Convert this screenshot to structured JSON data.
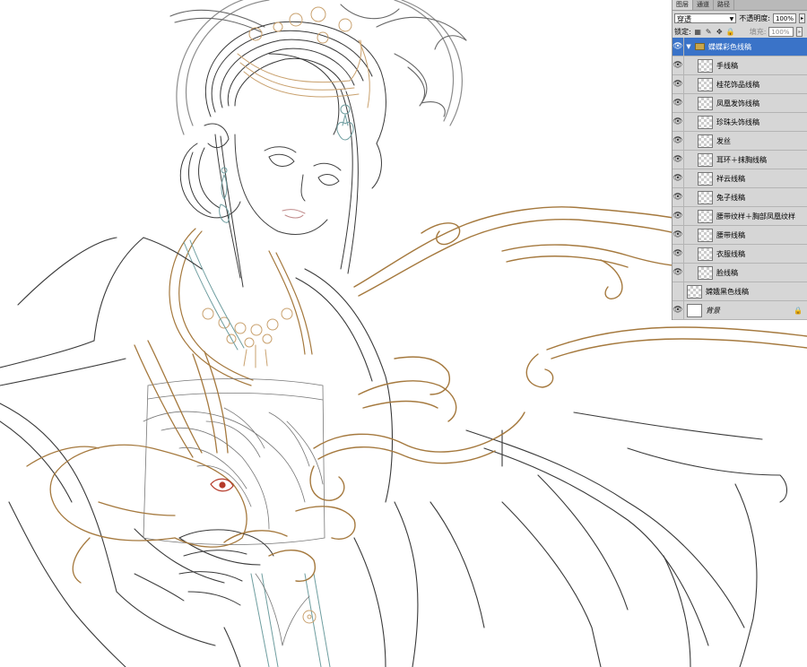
{
  "panel": {
    "tabs": [
      "图层",
      "通道",
      "路径"
    ],
    "blend_mode": "穿透",
    "opacity_label": "不透明度:",
    "opacity_value": "100%",
    "lock_label": "锁定:",
    "fill_label": "填充:",
    "fill_value": "100%"
  },
  "layers": [
    {
      "name": "蝶蝶彩色线稿",
      "type": "group",
      "visible": true,
      "selected": true
    },
    {
      "name": "手线稿",
      "visible": true
    },
    {
      "name": "桂花饰品线稿",
      "visible": true
    },
    {
      "name": "凤凰发饰线稿",
      "visible": true
    },
    {
      "name": "珍珠头饰线稿",
      "visible": true
    },
    {
      "name": "发丝",
      "visible": true
    },
    {
      "name": "耳环＋抹胸线稿",
      "visible": true
    },
    {
      "name": "祥云线稿",
      "visible": true
    },
    {
      "name": "兔子线稿",
      "visible": true
    },
    {
      "name": "腰带纹样＋胸部凤凰纹样",
      "visible": true
    },
    {
      "name": "腰带线稿",
      "visible": true
    },
    {
      "name": "衣服线稿",
      "visible": true
    },
    {
      "name": "脸线稿",
      "visible": true
    },
    {
      "name": "嫦娥黑色线稿",
      "visible": false
    },
    {
      "name": "背景",
      "visible": true,
      "locked": true
    }
  ],
  "icons": {
    "eye": "eye-icon",
    "lock": "lock-icon",
    "folder": "folder-icon"
  },
  "colors": {
    "line_dark": "#3a3a3a",
    "line_gold": "#a5793e",
    "line_flower": "#d9b07e",
    "line_teal": "#6f9ea0",
    "selection": "#3a73c8"
  }
}
